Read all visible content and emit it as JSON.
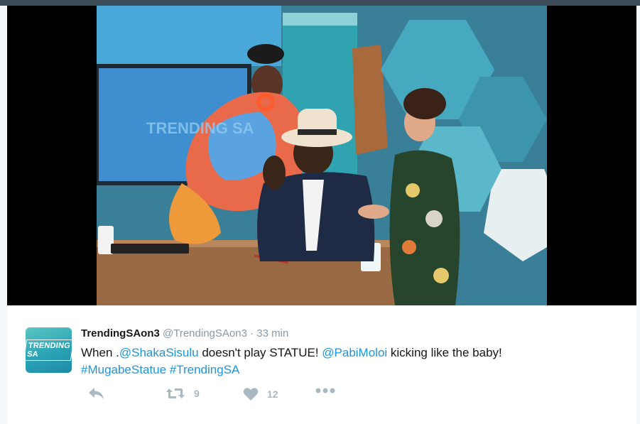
{
  "tweet": {
    "display_name": "TrendingSAon3",
    "handle": "@TrendingSAon3",
    "separator": "·",
    "time": "33 min",
    "text_prefix": "When .",
    "mention1": "@ShakaSisulu",
    "text_mid": " doesn't play STATUE! ",
    "mention2": "@PabiMoloi",
    "text_suffix": " kicking like the baby!",
    "hashtag1": "#MugabeStatue",
    "hashtag_space": " ",
    "hashtag2": "#TrendingSA",
    "avatar_text": "TRENDING SA",
    "photo_logo": "TRENDING SA"
  },
  "actions": {
    "reply_icon": "reply-icon",
    "retweet_icon": "retweet-icon",
    "retweet_count": "9",
    "like_icon": "heart-icon",
    "like_count": "12",
    "more_icon": "more-icon"
  },
  "colors": {
    "link": "#1b95e0",
    "muted": "#8899a6",
    "action": "#aab8c2",
    "text": "#14171a"
  }
}
